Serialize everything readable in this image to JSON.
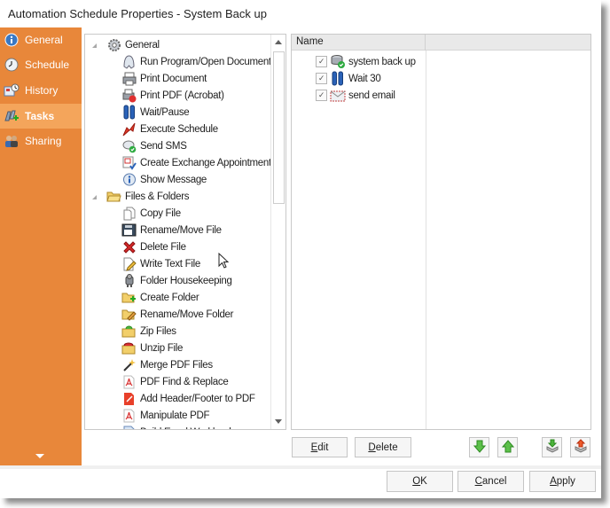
{
  "window": {
    "title": "Automation Schedule Properties - System Back up"
  },
  "colors": {
    "sidebar": "#e8873a",
    "sidebar_active": "#f4a55b"
  },
  "sidebar": {
    "items": [
      {
        "label": "General",
        "icon": "info-icon",
        "active": false
      },
      {
        "label": "Schedule",
        "icon": "clock-icon",
        "active": false
      },
      {
        "label": "History",
        "icon": "history-icon",
        "active": false
      },
      {
        "label": "Tasks",
        "icon": "tasks-icon",
        "active": true
      },
      {
        "label": "Sharing",
        "icon": "sharing-icon",
        "active": false
      }
    ],
    "more_icon": "chevron-down-icon"
  },
  "task_tree": {
    "groups": [
      {
        "label": "General",
        "icon": "gear-icon",
        "items": [
          {
            "label": "Run Program/Open Document",
            "icon": "run-program-icon"
          },
          {
            "label": "Print Document",
            "icon": "printer-icon"
          },
          {
            "label": "Print PDF (Acrobat)",
            "icon": "print-pdf-icon"
          },
          {
            "label": "Wait/Pause",
            "icon": "pause-icon"
          },
          {
            "label": "Execute Schedule",
            "icon": "execute-schedule-icon"
          },
          {
            "label": "Send SMS",
            "icon": "sms-icon"
          },
          {
            "label": "Create Exchange Appointment",
            "icon": "appointment-icon"
          },
          {
            "label": "Show Message",
            "icon": "message-icon"
          }
        ]
      },
      {
        "label": "Files & Folders",
        "icon": "folder-icon",
        "items": [
          {
            "label": "Copy File",
            "icon": "copy-file-icon"
          },
          {
            "label": "Rename/Move File",
            "icon": "rename-file-icon"
          },
          {
            "label": "Delete File",
            "icon": "delete-icon"
          },
          {
            "label": "Write Text File",
            "icon": "write-file-icon"
          },
          {
            "label": "Folder Housekeeping",
            "icon": "housekeeping-icon"
          },
          {
            "label": "Create Folder",
            "icon": "create-folder-icon"
          },
          {
            "label": "Rename/Move Folder",
            "icon": "rename-folder-icon"
          },
          {
            "label": "Zip Files",
            "icon": "zip-icon"
          },
          {
            "label": "Unzip File",
            "icon": "unzip-icon"
          },
          {
            "label": "Merge PDF Files",
            "icon": "merge-pdf-icon"
          },
          {
            "label": "PDF Find & Replace",
            "icon": "pdf-icon"
          },
          {
            "label": "Add Header/Footer to PDF",
            "icon": "pdf-header-icon"
          },
          {
            "label": "Manipulate PDF",
            "icon": "pdf-icon"
          },
          {
            "label": "Build Excel Workbook",
            "icon": "excel-icon"
          }
        ]
      }
    ]
  },
  "task_list": {
    "columns": [
      "Name",
      ""
    ],
    "rows": [
      {
        "name": "system back up",
        "checked": true,
        "icon": "backup-icon"
      },
      {
        "name": "Wait 30",
        "checked": true,
        "icon": "pause-icon"
      },
      {
        "name": "send email",
        "checked": true,
        "icon": "email-icon"
      }
    ]
  },
  "actions": {
    "edit": "Edit",
    "edit_key": "E",
    "delete": "Delete",
    "delete_key": "D",
    "move_down": "move-down-icon",
    "move_up": "move-up-icon",
    "import": "import-icon",
    "export": "export-icon"
  },
  "footer": {
    "ok": "OK",
    "ok_key": "O",
    "cancel": "Cancel",
    "cancel_key": "C",
    "apply": "Apply",
    "apply_key": "A"
  }
}
